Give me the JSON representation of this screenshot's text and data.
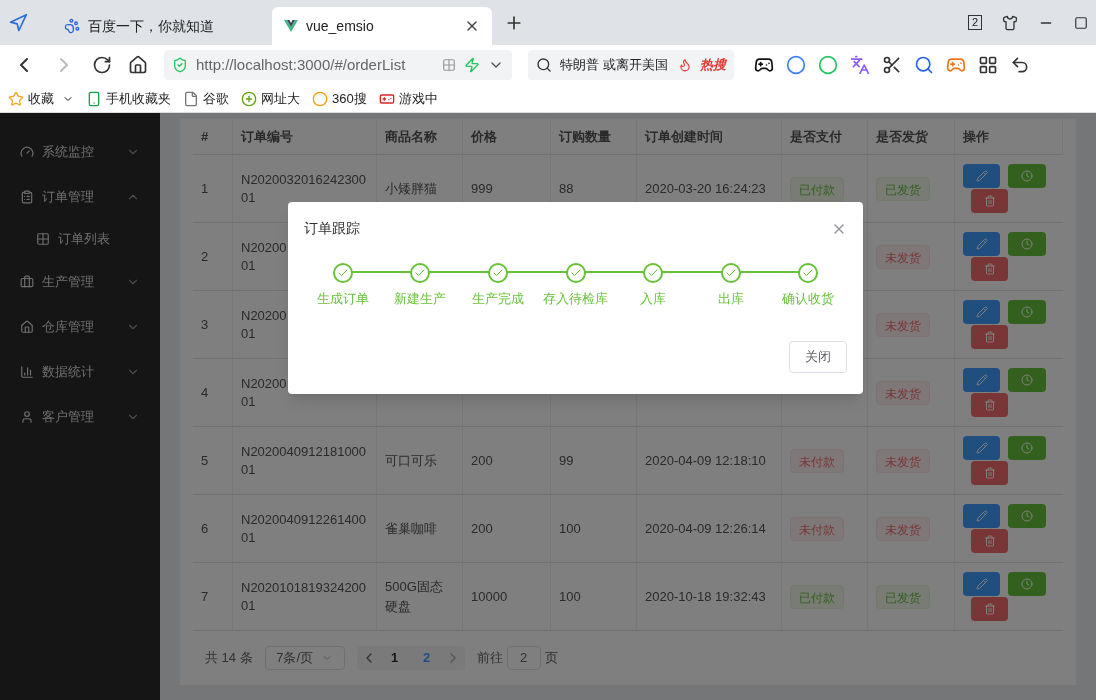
{
  "browser": {
    "tabs": [
      {
        "label": "百度一下，你就知道",
        "selected": false,
        "kind": "baidu"
      },
      {
        "label": "vue_emsio",
        "selected": true,
        "kind": "vue"
      }
    ],
    "tab_count": "2",
    "url": "http://localhost:3000/#/orderList",
    "search": {
      "value": "特朗普 或离开美国",
      "badge": "热搜"
    },
    "bookmarks": [
      {
        "label": "收藏",
        "kind": "star"
      },
      {
        "label": "手机收藏夹",
        "kind": "phone"
      },
      {
        "label": "谷歌",
        "kind": "page"
      },
      {
        "label": "网址大",
        "kind": "plus"
      },
      {
        "label": "360搜",
        "kind": "ring"
      },
      {
        "label": "游戏中",
        "kind": "game"
      }
    ]
  },
  "sidebar": {
    "items": [
      {
        "label": "系统监控",
        "expanded": false
      },
      {
        "label": "订单管理",
        "expanded": true,
        "children": [
          {
            "label": "订单列表"
          }
        ]
      },
      {
        "label": "生产管理",
        "expanded": false
      },
      {
        "label": "仓库管理",
        "expanded": false
      },
      {
        "label": "数据统计",
        "expanded": false
      },
      {
        "label": "客户管理",
        "expanded": false
      }
    ]
  },
  "table": {
    "columns": [
      "#",
      "订单编号",
      "商品名称",
      "价格",
      "订购数量",
      "订单创建时间",
      "是否支付",
      "是否发货",
      "操作"
    ],
    "rows": [
      {
        "index": "1",
        "order_no": [
          "N2020032016242300",
          "01"
        ],
        "product": "小矮胖猫",
        "price": "999",
        "quantity": "88",
        "created": "2020-03-20 16:24:23",
        "paid": {
          "label": "已付款",
          "on": true
        },
        "shipped": {
          "label": "已发货",
          "on": true
        }
      },
      {
        "index": "2",
        "order_no": [
          "N20200",
          "01"
        ],
        "shipped": {
          "label": "未发货",
          "on": false
        }
      },
      {
        "index": "3",
        "order_no": [
          "N20200",
          "01"
        ],
        "shipped": {
          "label": "未发货",
          "on": false
        }
      },
      {
        "index": "4",
        "order_no": [
          "N20200",
          "01"
        ],
        "shipped": {
          "label": "未发货",
          "on": false
        }
      },
      {
        "index": "5",
        "order_no": [
          "N2020040912181000",
          "01"
        ],
        "product": "可口可乐",
        "price": "200",
        "quantity": "99",
        "created": "2020-04-09 12:18:10",
        "paid": {
          "label": "未付款",
          "on": false
        },
        "shipped": {
          "label": "未发货",
          "on": false
        }
      },
      {
        "index": "6",
        "order_no": [
          "N2020040912261400",
          "01"
        ],
        "product": "雀巢咖啡",
        "price": "200",
        "quantity": "100",
        "created": "2020-04-09 12:26:14",
        "paid": {
          "label": "未付款",
          "on": false
        },
        "shipped": {
          "label": "未发货",
          "on": false
        }
      },
      {
        "index": "7",
        "order_no": [
          "N2020101819324200",
          "01"
        ],
        "product": "500G固态硬盘",
        "price": "10000",
        "quantity": "100",
        "created": "2020-10-18 19:32:43",
        "paid": {
          "label": "已付款",
          "on": true
        },
        "shipped": {
          "label": "已发货",
          "on": true
        }
      }
    ]
  },
  "pagination": {
    "total": "共 14 条",
    "page_size": "7条/页",
    "pages": [
      {
        "label": "1",
        "selected": false
      },
      {
        "label": "2",
        "selected": true
      }
    ],
    "goto_label": "前往",
    "goto_value": "2",
    "goto_suffix": "页"
  },
  "dialog": {
    "title": "订单跟踪",
    "steps": [
      {
        "label": "生成订单",
        "done": true
      },
      {
        "label": "新建生产",
        "done": true
      },
      {
        "label": "生产完成",
        "done": true
      },
      {
        "label": "存入待检库",
        "done": true
      },
      {
        "label": "入库",
        "done": true
      },
      {
        "label": "出库",
        "done": true
      },
      {
        "label": "确认收货",
        "done": true
      }
    ],
    "close_button": "关闭"
  }
}
